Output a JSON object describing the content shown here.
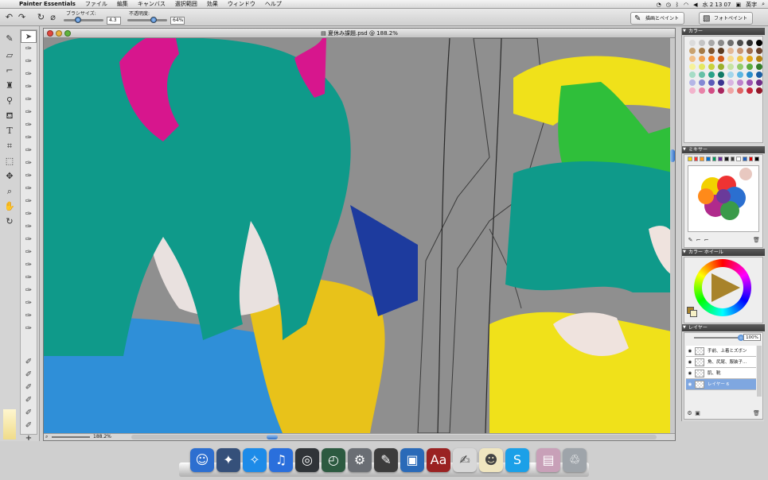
{
  "menubar": {
    "app_name": "Painter Essentials",
    "menus": [
      "ファイル",
      "編集",
      "キャンバス",
      "選択範囲",
      "効果",
      "ウィンドウ",
      "ヘルプ"
    ],
    "clock": "水 2 13 07",
    "input_source": "英字"
  },
  "options_bar": {
    "brush_size_label": "ブラシサイズ:",
    "brush_size_value": "4.3",
    "opacity_label": "不透明度:",
    "opacity_value": "64%",
    "brush_size_level": 0.3,
    "opacity_level": 0.64,
    "workspaces": [
      {
        "label": "描画とペイント",
        "active": true
      },
      {
        "label": "フォトペイント",
        "active": false
      }
    ]
  },
  "document": {
    "title": "夏休み課題.psd @ 188.2%",
    "zoom": "188.2%"
  },
  "panels": {
    "colors": {
      "title": "カラー",
      "swatches": [
        "#dcdcdc",
        "#c4c4c4",
        "#a8a8a8",
        "#8a8a8a",
        "#6e6e6e",
        "#4c4c4c",
        "#2e2e2e",
        "#000000",
        "#c9a26f",
        "#a57a45",
        "#7e5530",
        "#5b3a20",
        "#e4b896",
        "#c99470",
        "#a06c4c",
        "#6c442d",
        "#f2c08a",
        "#f1a052",
        "#ed7d22",
        "#d05c1c",
        "#f6dc8c",
        "#f0c84c",
        "#e2a81a",
        "#b48212",
        "#f6f29a",
        "#e4e862",
        "#c8d23c",
        "#9ab02c",
        "#c6e4a2",
        "#92cc6a",
        "#5cac3e",
        "#347c2a",
        "#a6dcc6",
        "#66c0a6",
        "#2aa288",
        "#107a66",
        "#a2d6ec",
        "#5cb6e2",
        "#2a8ecc",
        "#1a5ea2",
        "#b4b6e6",
        "#8288d4",
        "#5a5ab8",
        "#3a3490",
        "#d8b4e2",
        "#bc82cc",
        "#9a52b0",
        "#6e2c86",
        "#f2b4cc",
        "#e882a8",
        "#d24c84",
        "#a8245e",
        "#f0a4a4",
        "#e06464",
        "#c8283c",
        "#921628"
      ]
    },
    "mixer": {
      "title": "ミキサー",
      "colors": [
        "#ffd700",
        "#ff3030",
        "#ff9a1a",
        "#0070d0",
        "#00a060",
        "#6a2a9a",
        "#1a1a1a",
        "#3a3a3a",
        "#ffffff",
        "#2060c0",
        "#e00000",
        "#000000"
      ]
    },
    "color_wheel": {
      "title": "カラー ホイール",
      "current_color": "#a8832a",
      "secondary_color": "#f7f1c6"
    },
    "layers": {
      "title": "レイヤー",
      "opacity": "100%",
      "items": [
        {
          "name": "手前、上着とズボン",
          "selected": false
        },
        {
          "name": "角、尻尾、服装子...",
          "selected": false
        },
        {
          "name": "肌、靴",
          "selected": false
        },
        {
          "name": "レイヤー 6",
          "selected": true
        }
      ]
    }
  },
  "dock": {
    "items": [
      {
        "name": "finder",
        "color": "#2d6fd0",
        "glyph": "☺"
      },
      {
        "name": "preview",
        "color": "#35507a",
        "glyph": "✦"
      },
      {
        "name": "safari",
        "color": "#1d8be8",
        "glyph": "✧"
      },
      {
        "name": "itunes",
        "color": "#2a6fdc",
        "glyph": "♫"
      },
      {
        "name": "dashboard",
        "color": "#303438",
        "glyph": "◎"
      },
      {
        "name": "time-machine",
        "color": "#2c5a40",
        "glyph": "◴"
      },
      {
        "name": "system-preferences",
        "color": "#6a6e74",
        "glyph": "⚙"
      },
      {
        "name": "painter",
        "color": "#3c3c3c",
        "glyph": "✎"
      },
      {
        "name": "photo-booth",
        "color": "#2a6ab8",
        "glyph": "▣"
      },
      {
        "name": "dictionary",
        "color": "#9a2222",
        "glyph": "Aa"
      },
      {
        "name": "textedit",
        "color": "#d8d8d8",
        "glyph": "✍"
      },
      {
        "name": "mascot-app",
        "color": "#f0e6c0",
        "glyph": "☻"
      },
      {
        "name": "skype",
        "color": "#1ba0e8",
        "glyph": "S"
      },
      {
        "name": "documents",
        "color": "#c8a0b8",
        "glyph": "▤"
      },
      {
        "name": "trash",
        "color": "#9ea4aa",
        "glyph": "♲"
      }
    ]
  }
}
